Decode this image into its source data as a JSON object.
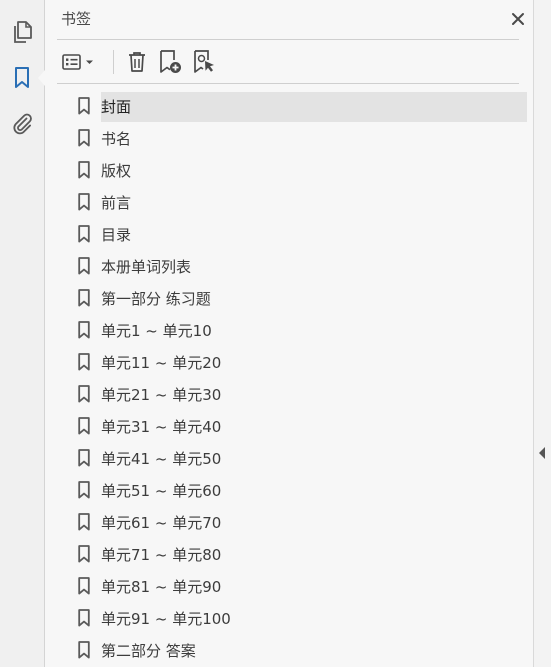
{
  "rail": {
    "items": [
      {
        "icon": "pages-icon",
        "active": false
      },
      {
        "icon": "bookmark-icon",
        "active": true
      },
      {
        "icon": "attachment-icon",
        "active": false
      }
    ]
  },
  "panel": {
    "title": "书签",
    "toolbar": {
      "options_icon": "list-options-icon",
      "delete_icon": "trash-icon",
      "new_bookmark_icon": "new-bookmark-icon",
      "bookmark_from_selection_icon": "bookmark-cursor-icon"
    },
    "bookmarks": [
      {
        "label": "封面",
        "selected": true
      },
      {
        "label": "书名",
        "selected": false
      },
      {
        "label": "版权",
        "selected": false
      },
      {
        "label": "前言",
        "selected": false
      },
      {
        "label": "目录",
        "selected": false
      },
      {
        "label": "本册单词列表",
        "selected": false
      },
      {
        "label": "第一部分  练习题",
        "selected": false
      },
      {
        "label": "单元1 ~ 单元10",
        "selected": false
      },
      {
        "label": "单元11 ~ 单元20",
        "selected": false
      },
      {
        "label": "单元21 ~ 单元30",
        "selected": false
      },
      {
        "label": "单元31 ~ 单元40",
        "selected": false
      },
      {
        "label": "单元41 ~ 单元50",
        "selected": false
      },
      {
        "label": "单元51 ~ 单元60",
        "selected": false
      },
      {
        "label": "单元61 ~ 单元70",
        "selected": false
      },
      {
        "label": "单元71 ~ 单元80",
        "selected": false
      },
      {
        "label": "单元81 ~ 单元90",
        "selected": false
      },
      {
        "label": "单元91 ~ 单元100",
        "selected": false
      },
      {
        "label": "第二部分  答案",
        "selected": false
      }
    ]
  },
  "colors": {
    "accent": "#2a6fb5",
    "icon_gray": "#5a5a5a",
    "selected_bg": "#e3e3e3"
  }
}
